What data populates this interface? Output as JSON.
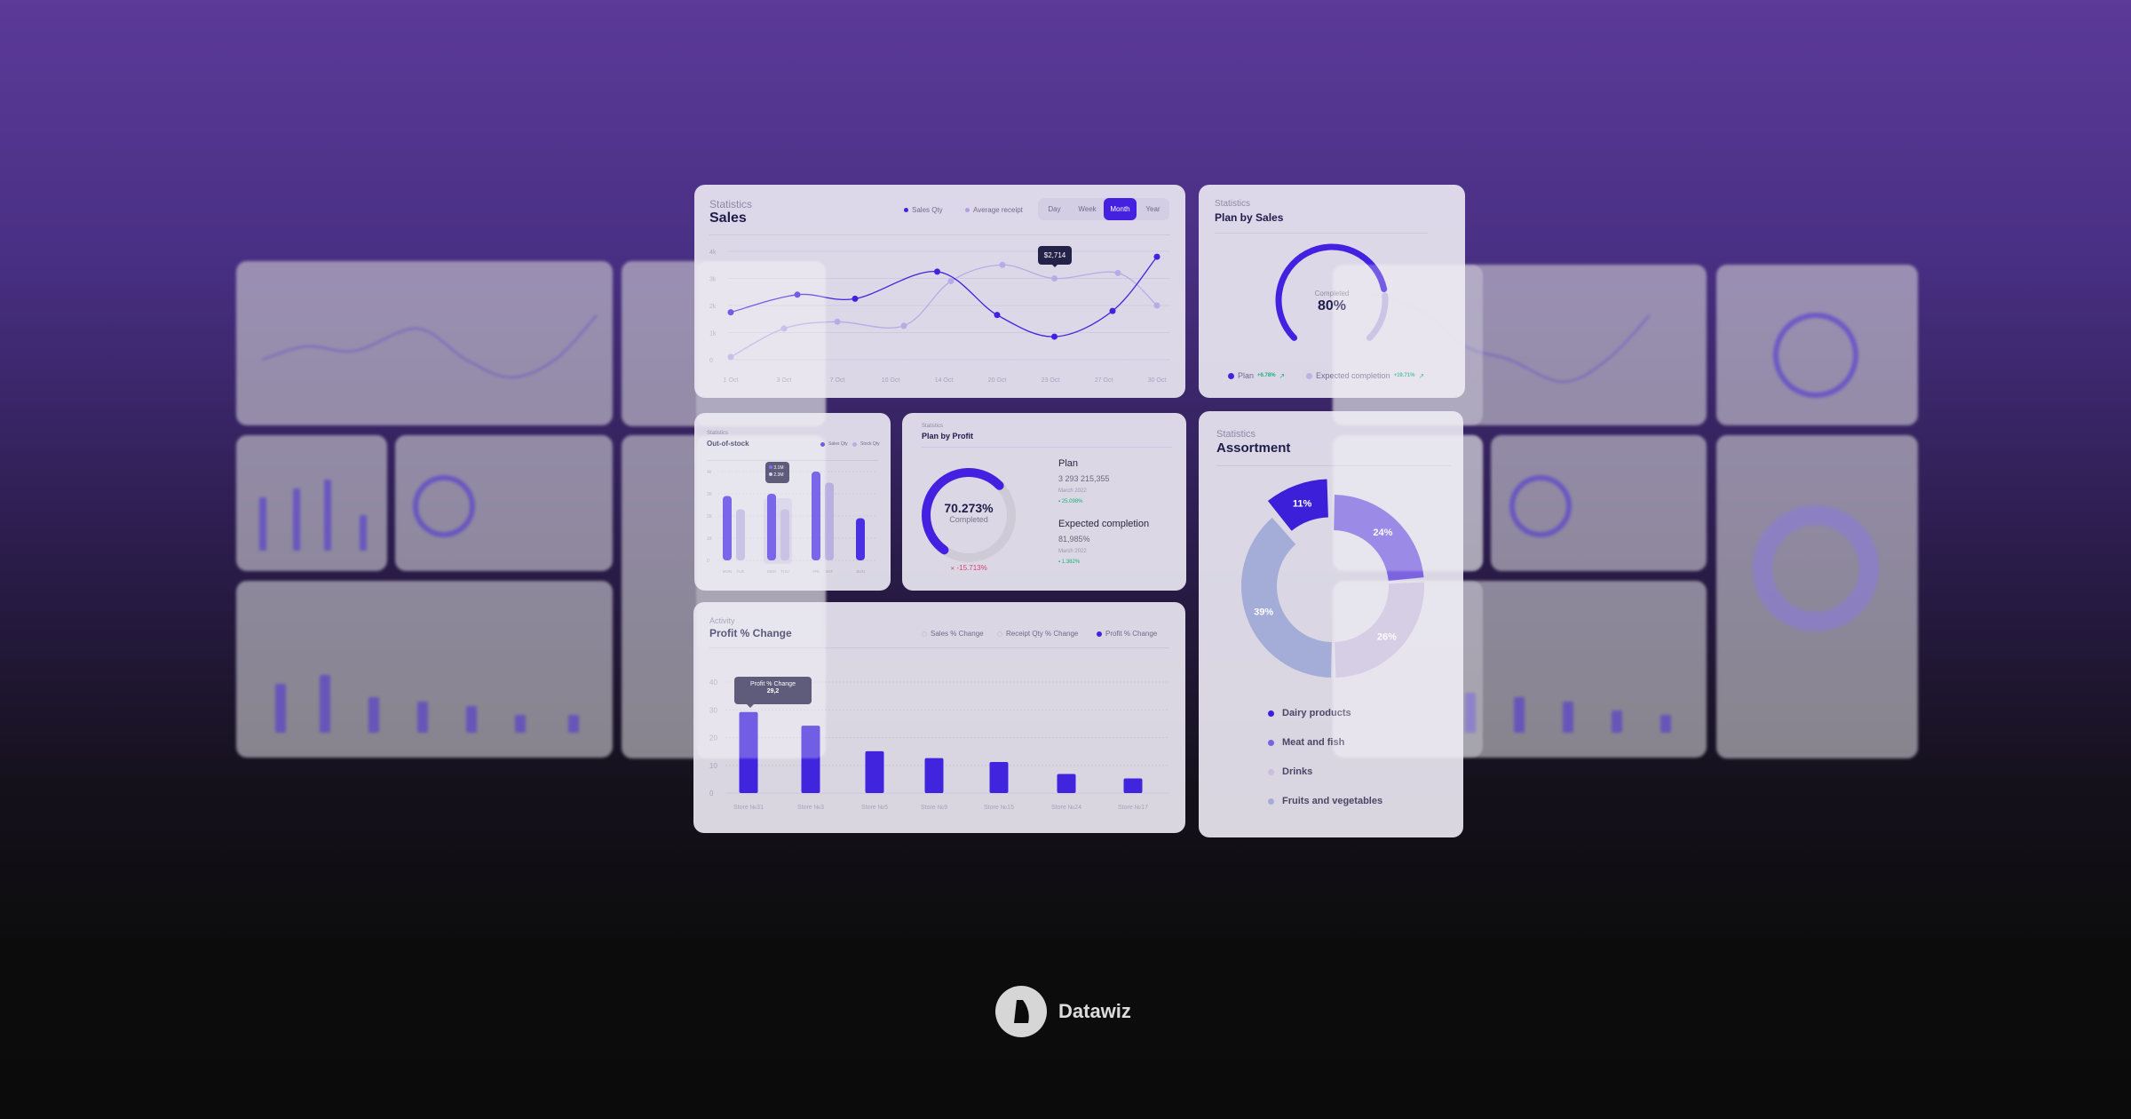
{
  "colors": {
    "accent": "#4421e0",
    "light_series": "#b9b0e0",
    "positive": "#18b27a",
    "negative": "#d2456a",
    "navy": "#1f1c4a"
  },
  "sales": {
    "subtitle": "Statistics",
    "title": "Sales",
    "legend": [
      "Sales Qty",
      "Average receipt"
    ],
    "periods": [
      "Day",
      "Week",
      "Month",
      "Year"
    ],
    "active_period": "Month",
    "tooltip": "$2,714",
    "chart_data": {
      "type": "line",
      "x_ticks": [
        "1 Oct",
        "3 Oct",
        "7 Oct",
        "10 Oct",
        "14 Oct",
        "20 Oct",
        "23 Oct",
        "27 Oct",
        "30 Oct"
      ],
      "x_tick_days": [
        1,
        3,
        7,
        10,
        14,
        20,
        23,
        27,
        30
      ],
      "y_ticks": [
        "0",
        "1k",
        "2k",
        "3k",
        "4k"
      ],
      "ylim": [
        0,
        4000
      ],
      "series": [
        {
          "name": "Sales Qty",
          "x": [
            1,
            4,
            8,
            13.5,
            20,
            23.3,
            27.5,
            30
          ],
          "y": [
            1750,
            2400,
            2250,
            3250,
            1650,
            850,
            1800,
            3800
          ]
        },
        {
          "name": "Average receipt",
          "x": [
            1,
            3,
            7,
            11,
            14.8,
            20.3,
            23.3,
            27.8,
            30
          ],
          "y": [
            100,
            1150,
            1400,
            1250,
            2900,
            3500,
            3000,
            3200,
            2000
          ]
        }
      ]
    }
  },
  "plan_sales": {
    "subtitle": "Statistics",
    "title": "Plan by Sales",
    "center_label": "Completed",
    "center_value": "80%",
    "completed_fraction": 0.8,
    "legend": [
      {
        "label": "Plan",
        "change": "+6.78%"
      },
      {
        "label": "Expected completion",
        "change": "+19.71%"
      }
    ]
  },
  "out_of_stock": {
    "subtitle": "Statistics",
    "title": "Out-of-stock",
    "legend": [
      "Sales Qty",
      "Stock Qty"
    ],
    "tooltip": [
      "3.1M",
      "2.3M"
    ],
    "chart_data": {
      "type": "bar",
      "categories": [
        "MON",
        "TUE",
        "WED",
        "THU",
        "FRI",
        "SAT",
        "SUN"
      ],
      "series_of_bar": [
        "Sales Qty",
        "Stock Qty",
        "Sales Qty",
        "Stock Qty",
        "Sales Qty",
        "Stock Qty",
        "Sales Qty"
      ],
      "values": [
        2900,
        2300,
        3000,
        2300,
        4000,
        3500,
        1900
      ],
      "y_ticks": [
        "0",
        "1K",
        "2K",
        "3K",
        "4k"
      ],
      "ylim": [
        0,
        4000
      ]
    }
  },
  "plan_profit": {
    "subtitle": "Statistics",
    "title": "Plan by Profit",
    "center_value": "70.273%",
    "center_label": "Completed",
    "completed_fraction": 0.70273,
    "change": "-15.713%",
    "plan": {
      "label": "Plan",
      "value": "3 293 215,355",
      "date": "March 2022",
      "change": "25.098%"
    },
    "expected": {
      "label": "Expected completion",
      "value": "81,985%",
      "date": "March 2022",
      "change": "1.382%"
    }
  },
  "profit_change": {
    "subtitle": "Activity",
    "title": "Profit % Change",
    "legend": [
      "Sales % Change",
      "Receipt Qty % Change",
      "Profit % Change"
    ],
    "tooltip": {
      "label": "Profit % Change",
      "value": "29,2"
    },
    "chart_data": {
      "type": "bar",
      "categories": [
        "Store №31",
        "Store №3",
        "Store №5",
        "Store №9",
        "Store №15",
        "Store №24",
        "Store №17"
      ],
      "values": [
        29.2,
        24.3,
        15.1,
        12.6,
        11.2,
        6.9,
        5.3
      ],
      "y_ticks": [
        "0",
        "10",
        "20",
        "30",
        "40"
      ],
      "ylim": [
        0,
        40
      ]
    }
  },
  "assortment": {
    "subtitle": "Statistics",
    "title": "Assortment",
    "chart_data": {
      "type": "pie",
      "slices": [
        {
          "label": "Dairy products",
          "value": 11,
          "text": "11%",
          "color": "#3b1fd9"
        },
        {
          "label": "Meat and fish",
          "value": 24,
          "text": "24%",
          "color": "#7b63e0"
        },
        {
          "label": "Drinks",
          "value": 26,
          "text": "26%",
          "color": "#c9bfdd"
        },
        {
          "label": "Fruits and vegetables",
          "value": 39,
          "text": "39%",
          "color": "#a4acd8"
        }
      ]
    }
  },
  "brand": {
    "name": "Datawiz"
  }
}
